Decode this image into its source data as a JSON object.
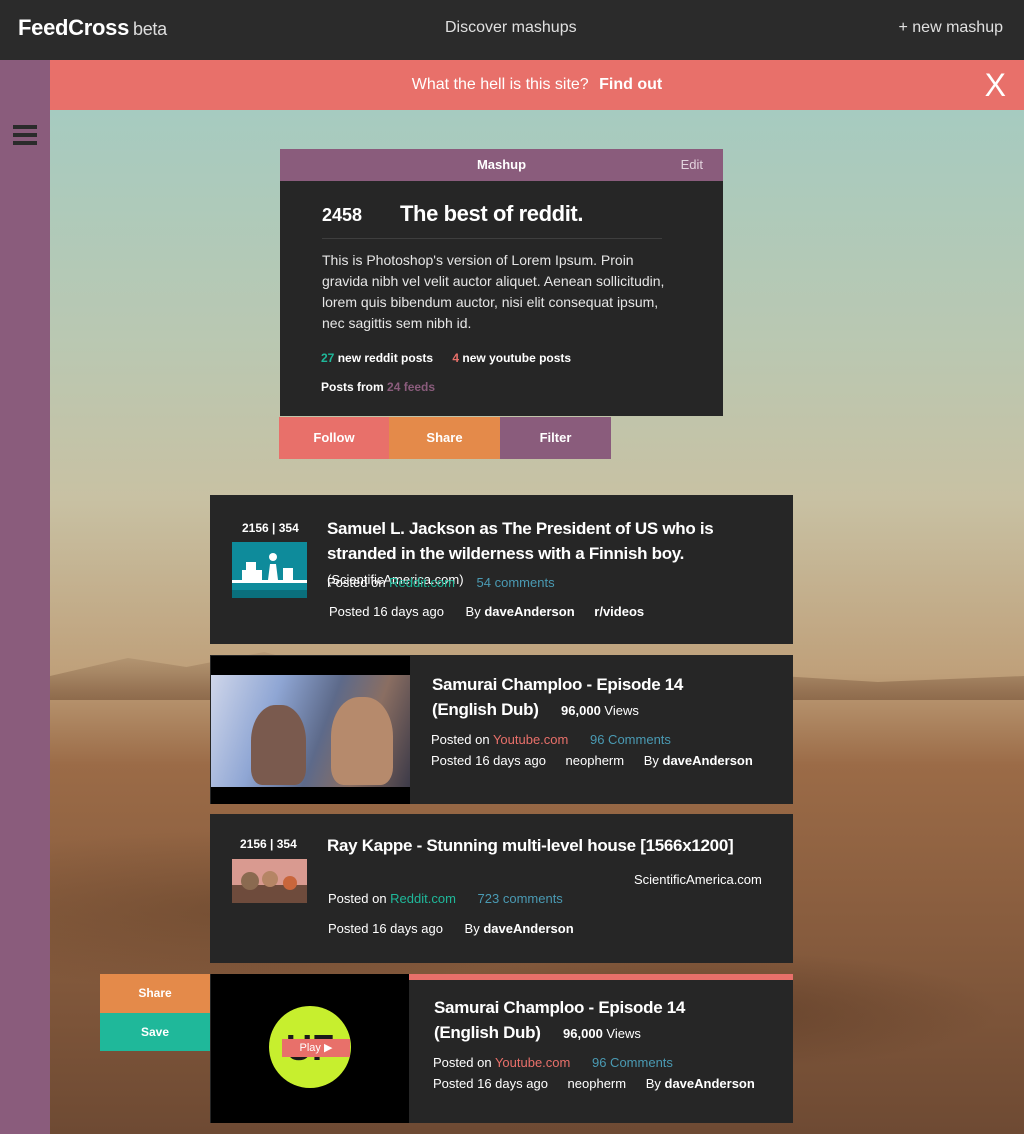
{
  "header": {
    "logo": "FeedCross",
    "logo_suffix": "beta",
    "discover_label": "Discover mashups",
    "new_mashup_label": "+ new mashup"
  },
  "banner": {
    "question": "What the hell is this site?",
    "link": "Find out",
    "close": "X"
  },
  "mashup": {
    "header_label": "Mashup",
    "edit_label": "Edit",
    "count": "2458",
    "title": "The best of reddit.",
    "description": "This is Photoshop's version  of Lorem Ipsum. Proin gravida nibh vel velit auctor aliquet. Aenean sollicitudin, lorem quis bibendum auctor, nisi elit consequat ipsum, nec sagittis sem nibh id.",
    "reddit_count": "27",
    "reddit_label": "new reddit posts",
    "youtube_count": "4",
    "youtube_label": "new youtube posts",
    "posts_from_label": "Posts from",
    "feeds_label": "24 feeds",
    "actions": {
      "follow": "Follow",
      "share": "Share",
      "filter": "Filter"
    }
  },
  "feed": [
    {
      "score": "2156 | 354",
      "title": "Samuel L. Jackson as The President of US who is stranded in the wilderness with a Finnish boy.",
      "source": "(ScientificAmerica.com)",
      "posted_on_label": "Posted on",
      "site": "Reddit.com",
      "comments": "54 comments",
      "posted": "Posted 16 days ago",
      "by_label": "By",
      "author": "daveAnderson",
      "subreddit": "r/videos"
    },
    {
      "title_line1": "Samurai Champloo - Episode 14",
      "title_line2": "(English Dub)",
      "views_count": "96,000",
      "views_label": "Views",
      "posted_on_label": "Posted on",
      "site": "Youtube.com",
      "comments": "96 Comments",
      "posted": "Posted 16 days ago",
      "channel": "neopherm",
      "by_label": "By",
      "author": "daveAnderson"
    },
    {
      "score": "2156 | 354",
      "title": "Ray Kappe - Stunning multi-level house [1566x1200]",
      "source": "ScientificAmerica.com",
      "posted_on_label": "Posted on",
      "site": "Reddit.com",
      "comments": "723 comments",
      "posted": "Posted 16 days ago",
      "by_label": "By",
      "author": "daveAnderson"
    },
    {
      "title_line1": "Samurai Champloo - Episode 14",
      "title_line2": "(English Dub)",
      "views_count": "96,000",
      "views_label": "Views",
      "posted_on_label": "Posted on",
      "site": "Youtube.com",
      "comments": "96 Comments",
      "posted": "Posted 16 days ago",
      "channel": "neopherm",
      "by_label": "By",
      "author": "daveAnderson",
      "play_label": "Play",
      "side_share": "Share",
      "side_save": "Save"
    }
  ],
  "colors": {
    "dark": "#2b2b2b",
    "card": "#262626",
    "coral": "#e8706a",
    "orange": "#e48a4a",
    "purple": "#8a5c7c",
    "teal": "#1fb89a",
    "blue": "#4a9ab3",
    "lime": "#c7ef2e"
  },
  "icons": [
    "hamburger-menu-icon",
    "close-icon",
    "play-icon"
  ]
}
